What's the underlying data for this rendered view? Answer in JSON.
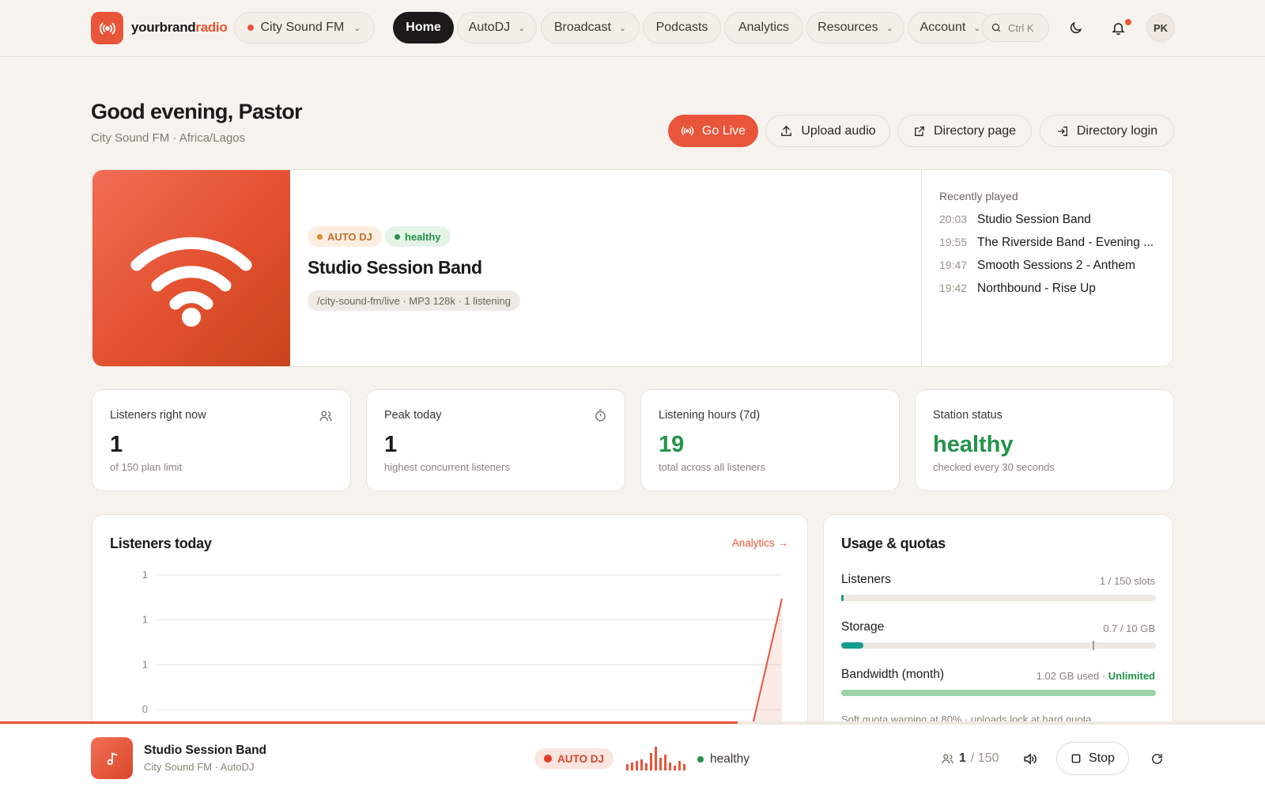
{
  "brand": {
    "name_a": "yourbrand",
    "name_b": "radio"
  },
  "station_selector": {
    "label": "City Sound FM"
  },
  "nav": {
    "home": "Home",
    "autodj": "AutoDJ",
    "broadcast": "Broadcast",
    "podcasts": "Podcasts",
    "analytics": "Analytics",
    "resources": "Resources",
    "account": "Account"
  },
  "search": {
    "shortcut": "Ctrl K"
  },
  "user": {
    "initials": "PK"
  },
  "header": {
    "greeting": "Good evening, Pastor",
    "subtitle": "City Sound FM · Africa/Lagos"
  },
  "actions": {
    "go_live": "Go Live",
    "upload": "Upload audio",
    "directory_page": "Directory page",
    "directory_login": "Directory login"
  },
  "now_playing": {
    "mode_badge": "AUTO DJ",
    "health_badge": "healthy",
    "title": "Studio Session Band",
    "mount_info": "/city-sound-fm/live · MP3 128k · 1 listening"
  },
  "recently_played": {
    "title": "Recently played",
    "items": [
      {
        "time": "20:03",
        "name": "Studio Session Band"
      },
      {
        "time": "19:55",
        "name": "The Riverside Band - Evening ..."
      },
      {
        "time": "19:47",
        "name": "Smooth Sessions 2 - Anthem"
      },
      {
        "time": "19:42",
        "name": "Northbound - Rise Up"
      }
    ]
  },
  "stats": {
    "listeners": {
      "label": "Listeners right now",
      "value": "1",
      "sub": "of 150 plan limit"
    },
    "peak": {
      "label": "Peak today",
      "value": "1",
      "sub": "highest concurrent listeners"
    },
    "hours": {
      "label": "Listening hours (7d)",
      "value": "19",
      "sub": "total across all listeners"
    },
    "status": {
      "label": "Station status",
      "value": "healthy",
      "sub": "checked every 30 seconds"
    }
  },
  "listeners_card": {
    "title": "Listeners today",
    "link": "Analytics"
  },
  "chart_data": {
    "type": "area",
    "y_tick_labels": [
      "1",
      "1",
      "1",
      "0"
    ],
    "ylim": [
      0,
      1
    ],
    "series": [
      {
        "values": [
          0,
          0,
          0,
          0,
          0,
          0,
          0,
          0,
          0,
          0,
          0,
          0,
          0,
          0,
          0,
          0,
          0,
          0,
          0,
          0,
          1
        ]
      }
    ],
    "grid": true,
    "color": "#e9553a"
  },
  "usage": {
    "title": "Usage & quotas",
    "listeners": {
      "label": "Listeners",
      "value": "1 / 150 slots",
      "fraction": 0.0067
    },
    "storage": {
      "label": "Storage",
      "value": "0.7 / 10 GB",
      "fraction": 0.07,
      "marker": 0.8
    },
    "bandwidth": {
      "label": "Bandwidth (month)",
      "value": "1.02 GB used",
      "sep": " · ",
      "unlimited": "Unlimited",
      "fraction": 1.0
    },
    "note": "Soft quota warning at 80% · uploads lock at hard quota."
  },
  "player": {
    "title": "Studio Session Band",
    "subtitle": "City Sound FM · AutoDJ",
    "badge": "AUTO DJ",
    "health": "healthy",
    "listeners": "1",
    "limit": "/ 150",
    "stop": "Stop",
    "progress": 0.583
  },
  "colors": {
    "accent": "#e9553a",
    "healthy": "#22934a",
    "teal": "#139b8c"
  }
}
